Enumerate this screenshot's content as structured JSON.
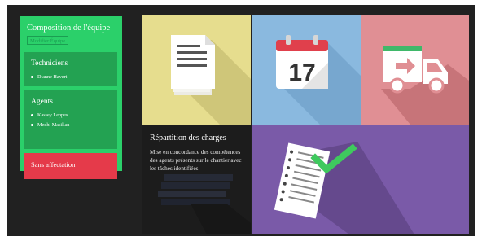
{
  "team_panel": {
    "title": "Composition de l'équipe",
    "edit_button": "Modifier Équipe",
    "groups": [
      {
        "title": "Techniciens",
        "members": [
          "Dianne Havert"
        ]
      },
      {
        "title": "Agents",
        "members": [
          "Kassey Leppes",
          "Medhi Masillan"
        ]
      },
      {
        "title": "Sans affectation",
        "members": []
      }
    ]
  },
  "tiles": {
    "documents": {
      "icon": "document-stack-icon"
    },
    "calendar": {
      "icon": "calendar-icon",
      "day": "17"
    },
    "delivery": {
      "icon": "truck-icon"
    },
    "repartition": {
      "title": "Répartition des charges",
      "description": "Mise en concordance des compétences des agents présents sur le chantier avec les tâches identifiées",
      "icon": "document-stack-icon"
    },
    "tasks": {
      "icon": "checklist-icon"
    }
  },
  "colors": {
    "panel_bg": "#2bd06a",
    "group_bg": "#23a252",
    "unassigned_bg": "#e53a4a",
    "tile_documents": "#e6dd8e",
    "tile_calendar": "#8ab9df",
    "tile_delivery": "#e08f94",
    "tile_repartition": "#1c1c1c",
    "tile_tasks": "#7a5aa8"
  }
}
